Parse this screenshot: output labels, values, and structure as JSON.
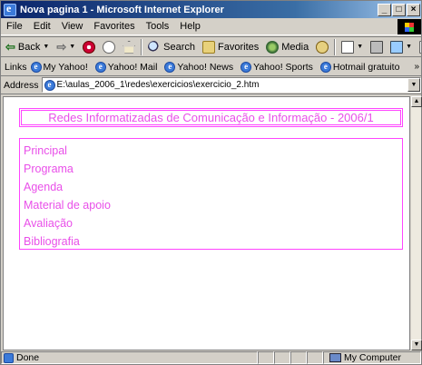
{
  "window": {
    "title": "Nova pagina 1 - Microsoft Internet Explorer",
    "buttons": [
      "_",
      "□",
      "×"
    ]
  },
  "menubar": {
    "items": [
      "File",
      "Edit",
      "View",
      "Favorites",
      "Tools",
      "Help"
    ]
  },
  "toolbar": {
    "back_label": "Back",
    "search_label": "Search",
    "favorites_label": "Favorites",
    "media_label": "Media"
  },
  "links_bar": {
    "label": "Links",
    "items": [
      "My Yahoo!",
      "Yahoo! Mail",
      "Yahoo! News",
      "Yahoo! Sports",
      "Hotmail gratuito"
    ]
  },
  "address_bar": {
    "label": "Address",
    "value": "E:\\aulas_2006_1\\redes\\exercicios\\exercicio_2.htm"
  },
  "page": {
    "header": "Redes Informatizadas de Comunicação e Informação - 2006/1",
    "nav": [
      "Principal",
      "Programa",
      "Agenda",
      "Material de apoio",
      "Avaliação",
      "Bibliografia"
    ]
  },
  "status_bar": {
    "text": "Done",
    "zone": "My Computer"
  },
  "colors": {
    "accent_magenta": "#e94fe9",
    "border_magenta": "#ff44ff"
  }
}
